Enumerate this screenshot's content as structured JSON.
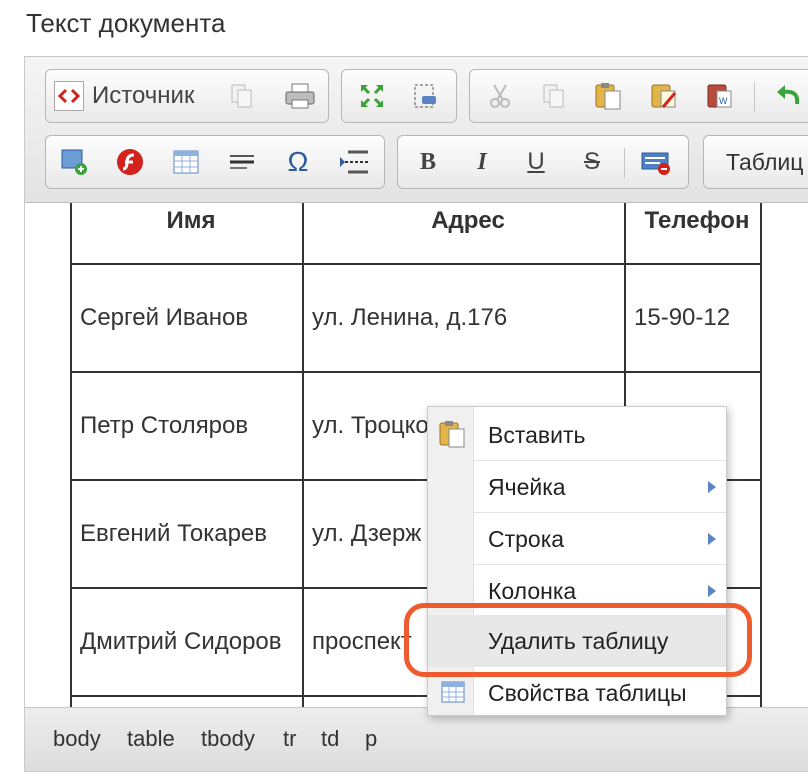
{
  "page": {
    "title": "Текст документа"
  },
  "toolbar": {
    "source_label": "Источник",
    "table_label": "Таблиц",
    "bold_label": "B",
    "italic_label": "I",
    "underline_label": "U",
    "strike_label": "S",
    "omega_label": "Ω",
    "accent_flash": "#d3221b",
    "accent_green": "#3aa43a"
  },
  "table": {
    "headers": [
      "Имя",
      "Адрес",
      "Телефон"
    ],
    "rows": [
      [
        "Сергей Иванов",
        "ул. Ленина, д.176",
        "15-90-12"
      ],
      [
        "Петр Столяров",
        "ул. Троцко",
        ""
      ],
      [
        "Евгений Токарев",
        "ул. Дзерж",
        ""
      ],
      [
        "Дмитрий Сидоров",
        "проспект",
        ""
      ]
    ]
  },
  "context_menu": {
    "items": [
      {
        "label": "Вставить",
        "icon": "paste-icon",
        "submenu": false
      },
      {
        "label": "Ячейка",
        "submenu": true
      },
      {
        "label": "Строка",
        "submenu": true
      },
      {
        "label": "Колонка",
        "submenu": true
      },
      {
        "label": "Удалить таблицу",
        "submenu": false,
        "highlighted": true
      },
      {
        "label": "Свойства таблицы",
        "icon": "table-properties-icon",
        "submenu": false
      }
    ],
    "highlight_color": "#ef5a2e"
  },
  "statusbar": {
    "path": [
      "body",
      "table",
      "tbody",
      "tr",
      "td",
      "p"
    ]
  }
}
